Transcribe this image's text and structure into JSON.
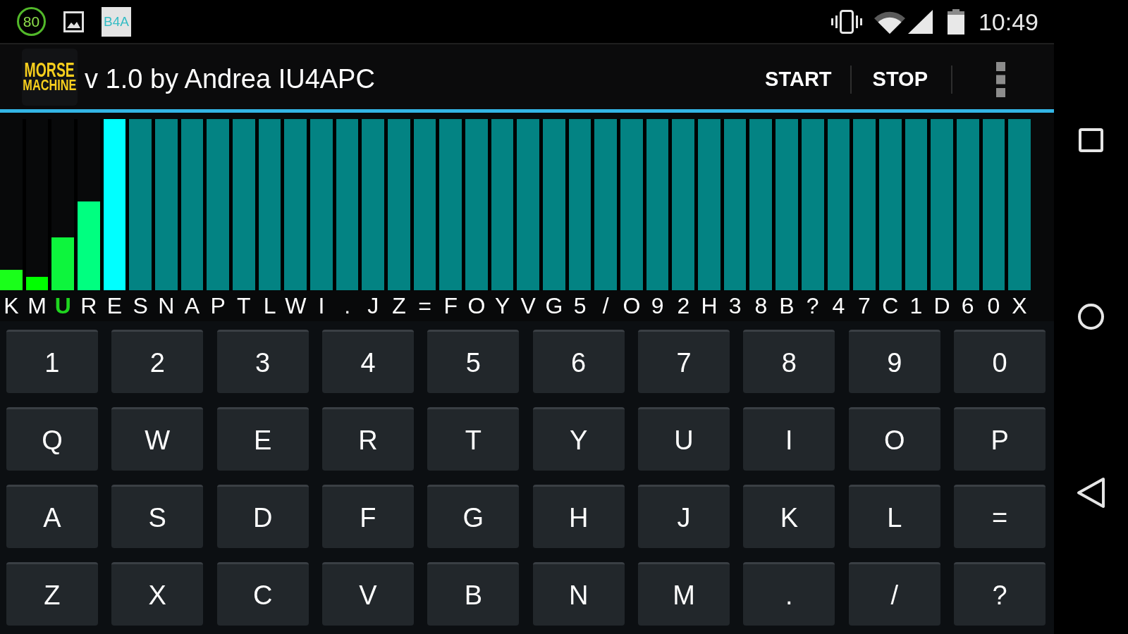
{
  "status_bar": {
    "notification_ring": "80",
    "notification_tile": "B4A",
    "time": "10:49"
  },
  "app_bar": {
    "logo": [
      "MORSE",
      "MACHINE"
    ],
    "title": "v 1.0 by Andrea IU4APC",
    "actions": [
      "START",
      "STOP"
    ]
  },
  "letters": [
    {
      "char": "K",
      "level": 0.12,
      "color": "#1aff1a",
      "selected": false
    },
    {
      "char": "M",
      "level": 0.08,
      "color": "#00ff00",
      "selected": false
    },
    {
      "char": "U",
      "level": 0.31,
      "color": "#0df53d",
      "selected": true
    },
    {
      "char": "R",
      "level": 0.52,
      "color": "#00ff80",
      "selected": false
    },
    {
      "char": "E",
      "level": 1,
      "color": "#00ffff",
      "selected": false
    },
    {
      "char": "S",
      "level": 1,
      "color": "#038383",
      "selected": false
    },
    {
      "char": "N",
      "level": 1,
      "color": "#038383",
      "selected": false
    },
    {
      "char": "A",
      "level": 1,
      "color": "#038383",
      "selected": false
    },
    {
      "char": "P",
      "level": 1,
      "color": "#038383",
      "selected": false
    },
    {
      "char": "T",
      "level": 1,
      "color": "#038383",
      "selected": false
    },
    {
      "char": "L",
      "level": 1,
      "color": "#038383",
      "selected": false
    },
    {
      "char": "W",
      "level": 1,
      "color": "#038383",
      "selected": false
    },
    {
      "char": "I",
      "level": 1,
      "color": "#038383",
      "selected": false
    },
    {
      "char": ".",
      "level": 1,
      "color": "#038383",
      "selected": false
    },
    {
      "char": "J",
      "level": 1,
      "color": "#038383",
      "selected": false
    },
    {
      "char": "Z",
      "level": 1,
      "color": "#038383",
      "selected": false
    },
    {
      "char": "=",
      "level": 1,
      "color": "#038383",
      "selected": false
    },
    {
      "char": "F",
      "level": 1,
      "color": "#038383",
      "selected": false
    },
    {
      "char": "O",
      "level": 1,
      "color": "#038383",
      "selected": false
    },
    {
      "char": "Y",
      "level": 1,
      "color": "#038383",
      "selected": false
    },
    {
      "char": "V",
      "level": 1,
      "color": "#038383",
      "selected": false
    },
    {
      "char": "G",
      "level": 1,
      "color": "#038383",
      "selected": false
    },
    {
      "char": "5",
      "level": 1,
      "color": "#038383",
      "selected": false
    },
    {
      "char": "/",
      "level": 1,
      "color": "#038383",
      "selected": false
    },
    {
      "char": "O",
      "level": 1,
      "color": "#038383",
      "selected": false
    },
    {
      "char": "9",
      "level": 1,
      "color": "#038383",
      "selected": false
    },
    {
      "char": "2",
      "level": 1,
      "color": "#038383",
      "selected": false
    },
    {
      "char": "H",
      "level": 1,
      "color": "#038383",
      "selected": false
    },
    {
      "char": "3",
      "level": 1,
      "color": "#038383",
      "selected": false
    },
    {
      "char": "8",
      "level": 1,
      "color": "#038383",
      "selected": false
    },
    {
      "char": "B",
      "level": 1,
      "color": "#038383",
      "selected": false
    },
    {
      "char": "?",
      "level": 1,
      "color": "#038383",
      "selected": false
    },
    {
      "char": "4",
      "level": 1,
      "color": "#038383",
      "selected": false
    },
    {
      "char": "7",
      "level": 1,
      "color": "#038383",
      "selected": false
    },
    {
      "char": "C",
      "level": 1,
      "color": "#038383",
      "selected": false
    },
    {
      "char": "1",
      "level": 1,
      "color": "#038383",
      "selected": false
    },
    {
      "char": "D",
      "level": 1,
      "color": "#038383",
      "selected": false
    },
    {
      "char": "6",
      "level": 1,
      "color": "#038383",
      "selected": false
    },
    {
      "char": "0",
      "level": 1,
      "color": "#038383",
      "selected": false
    },
    {
      "char": "X",
      "level": 1,
      "color": "#038383",
      "selected": false
    }
  ],
  "keyboard": {
    "rows": [
      [
        "1",
        "2",
        "3",
        "4",
        "5",
        "6",
        "7",
        "8",
        "9",
        "0"
      ],
      [
        "Q",
        "W",
        "E",
        "R",
        "T",
        "Y",
        "U",
        "I",
        "O",
        "P"
      ],
      [
        "A",
        "S",
        "D",
        "F",
        "G",
        "H",
        "J",
        "K",
        "L",
        "="
      ],
      [
        "Z",
        "X",
        "C",
        "V",
        "B",
        "N",
        "M",
        ".",
        "/",
        "?"
      ]
    ]
  }
}
